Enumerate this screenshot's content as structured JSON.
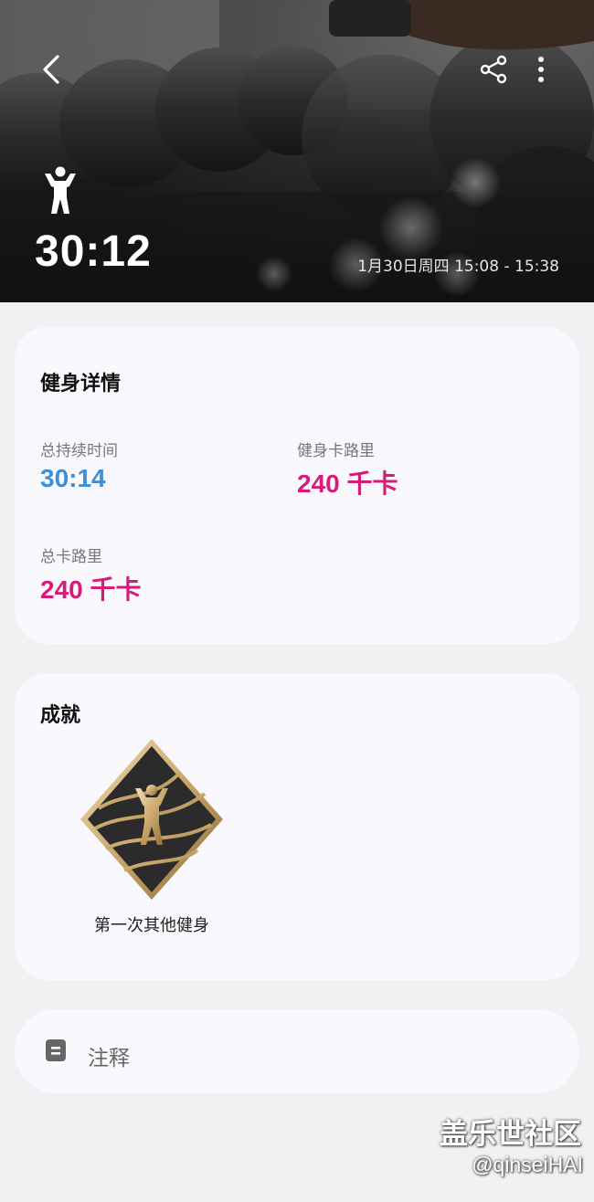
{
  "header": {
    "duration": "30:12",
    "date_range": "1月30日周四 15:08 - 15:38"
  },
  "details": {
    "title": "健身详情",
    "stats": [
      {
        "label": "总持续时间",
        "value": "30:14",
        "color": "#3d8fd6"
      },
      {
        "label": "健身卡路里",
        "value": "240 千卡",
        "color": "#d81b7a"
      },
      {
        "label": "总卡路里",
        "value": "240 千卡",
        "color": "#d81b7a"
      }
    ]
  },
  "achievements": {
    "title": "成就",
    "badge_label": "第一次其他健身"
  },
  "notes": {
    "label": "注释"
  },
  "watermark": {
    "title": "盖乐世社区",
    "handle": "@qinseiHAI"
  },
  "icons": {
    "back": "chevron-left-icon",
    "share": "share-icon",
    "more": "more-vertical-icon",
    "activity": "weightlifting-person-icon",
    "note": "note-icon"
  }
}
